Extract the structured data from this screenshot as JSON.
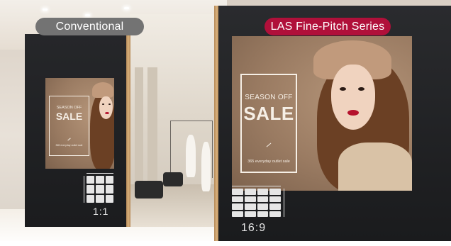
{
  "labels": {
    "conventional": "Conventional",
    "las": "LAS Fine-Pitch Series"
  },
  "screen_left": {
    "season": "SEASON OFF",
    "sale": "SALE",
    "sub": "365 everyday outlet sale",
    "ratio": "1:1"
  },
  "screen_right": {
    "season": "SEASON OFF",
    "sale": "SALE",
    "sub": "365 everyday outlet sale",
    "ratio": "16:9"
  },
  "colors": {
    "las_accent": "#b0103a",
    "conventional_pill": "#737373",
    "wall": "#222326"
  }
}
